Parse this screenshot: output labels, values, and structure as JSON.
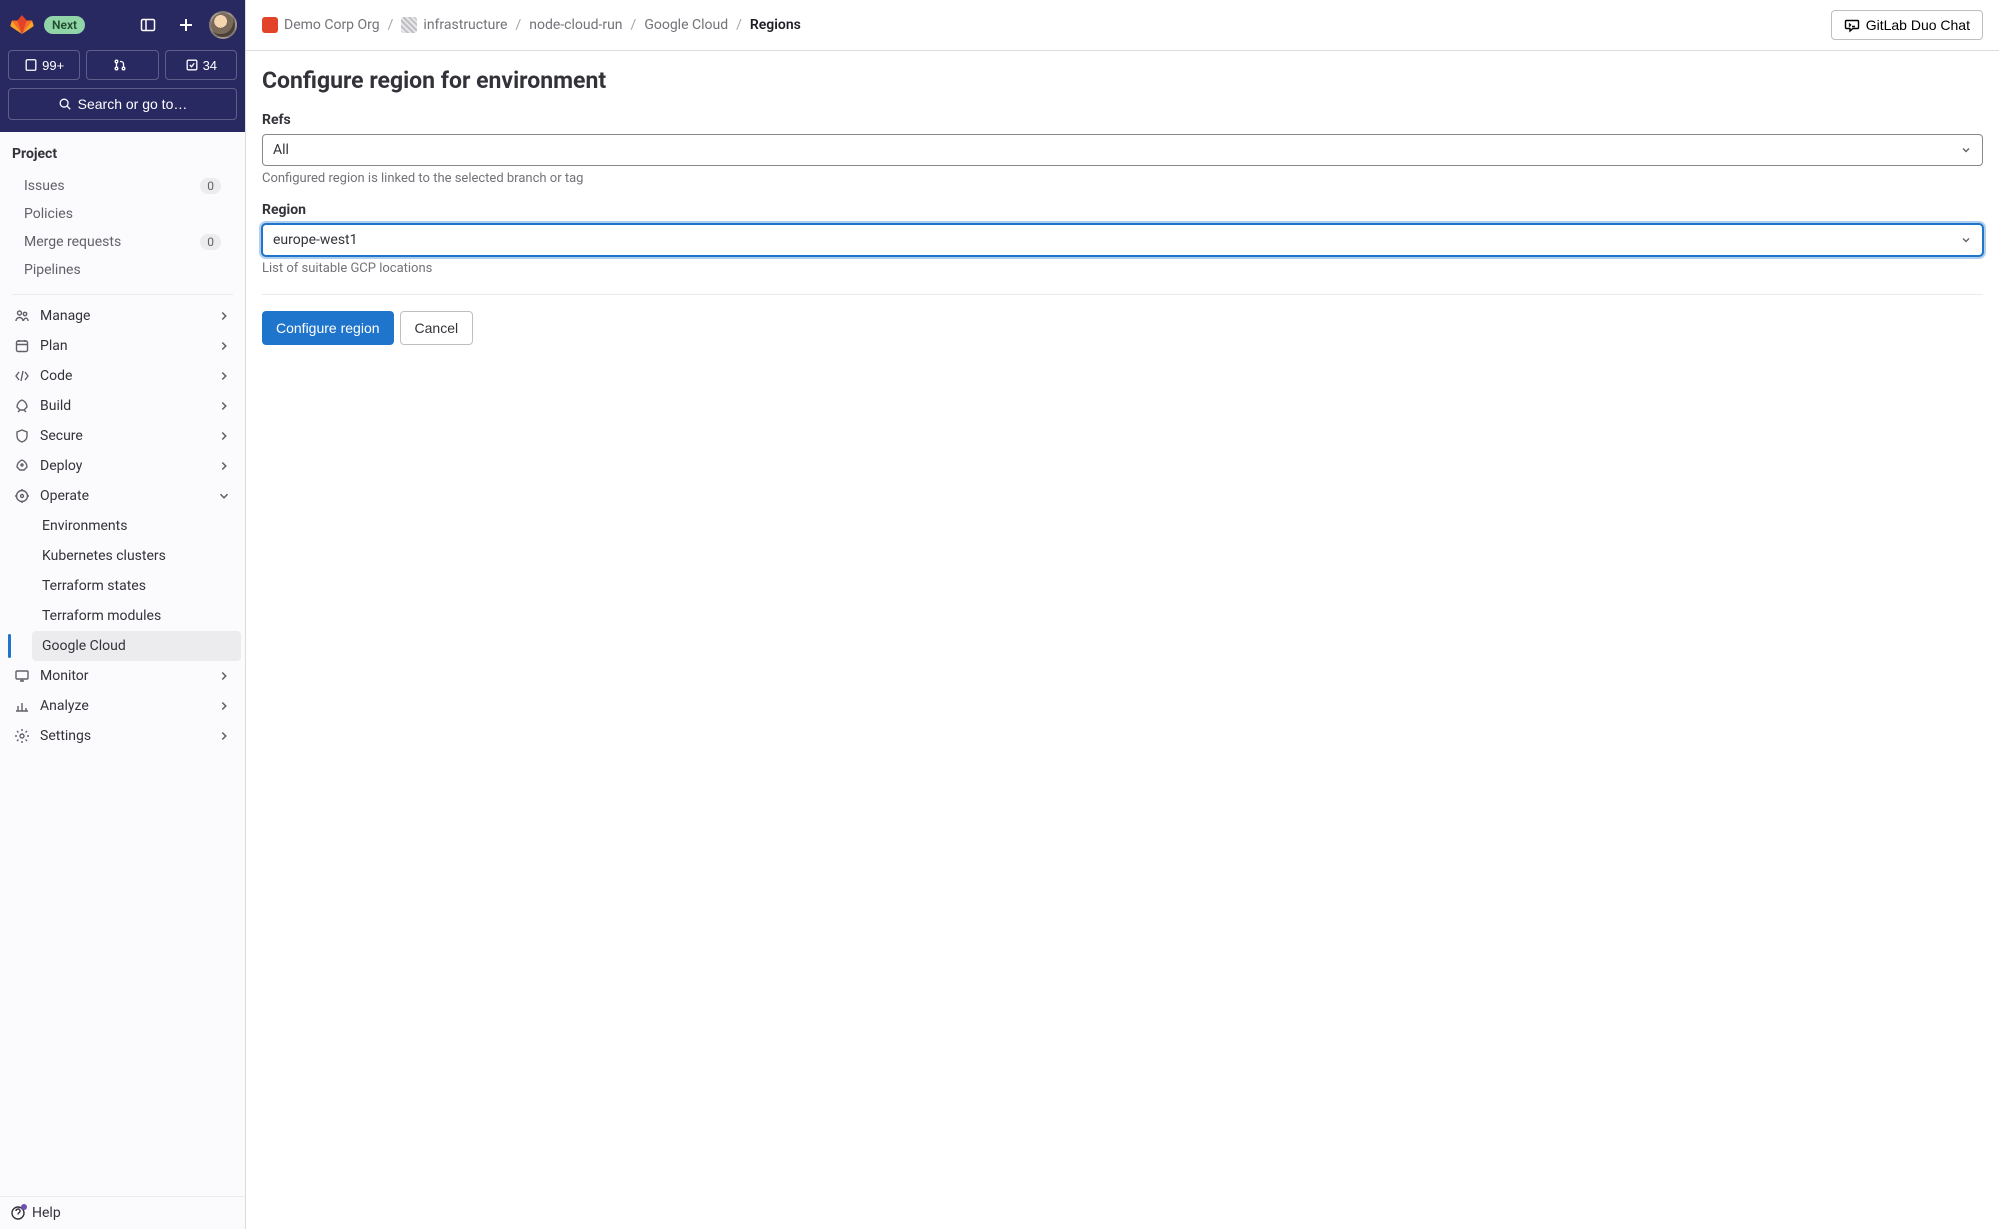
{
  "header": {
    "next_badge": "Next",
    "issue_count": "99+",
    "mr_count": "",
    "todo_count": "34",
    "search_label": "Search or go to…"
  },
  "sidebar": {
    "section_title": "Project",
    "top_items": [
      {
        "label": "Issues",
        "count": "0"
      },
      {
        "label": "Policies",
        "count": ""
      },
      {
        "label": "Merge requests",
        "count": "0"
      },
      {
        "label": "Pipelines",
        "count": ""
      }
    ],
    "nav": [
      {
        "label": "Manage"
      },
      {
        "label": "Plan"
      },
      {
        "label": "Code"
      },
      {
        "label": "Build"
      },
      {
        "label": "Secure"
      },
      {
        "label": "Deploy"
      },
      {
        "label": "Operate",
        "expanded": true,
        "children": [
          {
            "label": "Environments"
          },
          {
            "label": "Kubernetes clusters"
          },
          {
            "label": "Terraform states"
          },
          {
            "label": "Terraform modules"
          },
          {
            "label": "Google Cloud",
            "active": true
          }
        ]
      },
      {
        "label": "Monitor"
      },
      {
        "label": "Analyze"
      },
      {
        "label": "Settings"
      }
    ],
    "help_label": "Help"
  },
  "breadcrumbs": {
    "items": [
      {
        "label": "Demo Corp Org"
      },
      {
        "label": "infrastructure"
      },
      {
        "label": "node-cloud-run"
      },
      {
        "label": "Google Cloud"
      },
      {
        "label": "Regions",
        "final": true
      }
    ]
  },
  "duo_chat_label": "GitLab Duo Chat",
  "page": {
    "title": "Configure region for environment",
    "refs": {
      "label": "Refs",
      "value": "All",
      "helper": "Configured region is linked to the selected branch or tag"
    },
    "region": {
      "label": "Region",
      "value": "europe-west1",
      "helper": "List of suitable GCP locations"
    },
    "submit_label": "Configure region",
    "cancel_label": "Cancel"
  }
}
